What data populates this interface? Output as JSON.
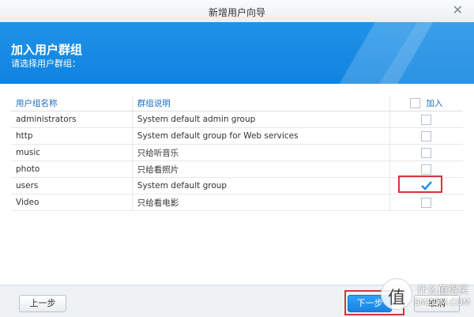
{
  "window": {
    "title": "新增用户向导",
    "close_icon": "close-icon"
  },
  "banner": {
    "heading": "加入用户群组",
    "subheading": "请选择用户群组："
  },
  "table": {
    "headers": [
      "用户组名称",
      "群组说明",
      "加入"
    ],
    "rows": [
      {
        "name": "administrators",
        "desc": "System default admin group",
        "checked": false
      },
      {
        "name": "http",
        "desc": "System default group for Web services",
        "checked": false
      },
      {
        "name": "music",
        "desc": "只给听音乐",
        "checked": false
      },
      {
        "name": "photo",
        "desc": "只给看照片",
        "checked": false
      },
      {
        "name": "users",
        "desc": "System default group",
        "checked": true
      },
      {
        "name": "Video",
        "desc": "只给看电影",
        "checked": false
      }
    ]
  },
  "footer": {
    "prev_label": "上一步",
    "next_label": "下一步",
    "cancel_label": "取消"
  },
  "watermark": {
    "line1": "什么值得买",
    "line2": "SMZDM.COM",
    "logo_char": "值"
  },
  "colors": {
    "accent": "#1a8be6",
    "highlight": "#d0363a"
  }
}
